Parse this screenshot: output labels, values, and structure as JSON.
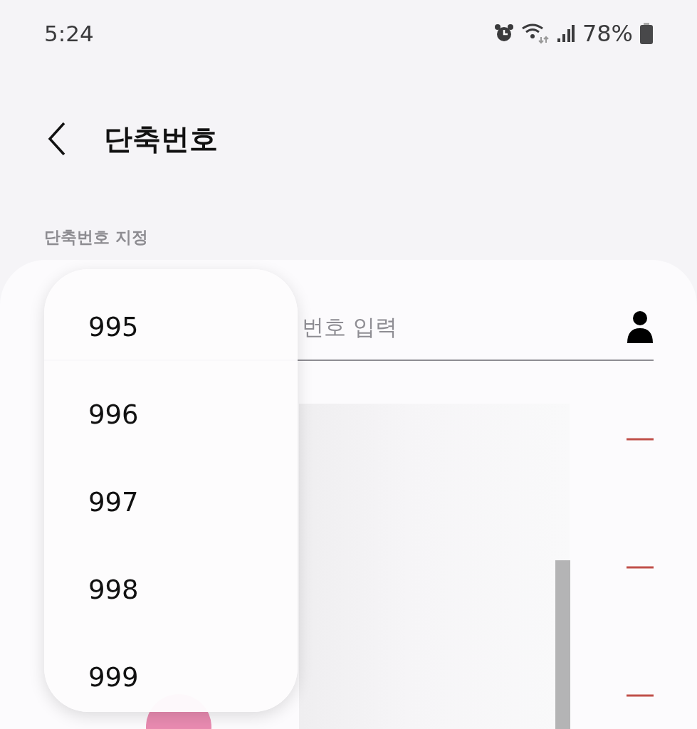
{
  "status_bar": {
    "time": "5:24",
    "battery": "78%"
  },
  "header": {
    "title": "단축번호"
  },
  "section": {
    "label": "단축번호 지정"
  },
  "number_field": {
    "placeholder": "번호 입력"
  },
  "rows": [
    {
      "removable": true
    },
    {
      "removable": true
    },
    {
      "removable": true
    }
  ],
  "number_menu": {
    "items": [
      "995",
      "996",
      "997",
      "998",
      "999"
    ]
  }
}
